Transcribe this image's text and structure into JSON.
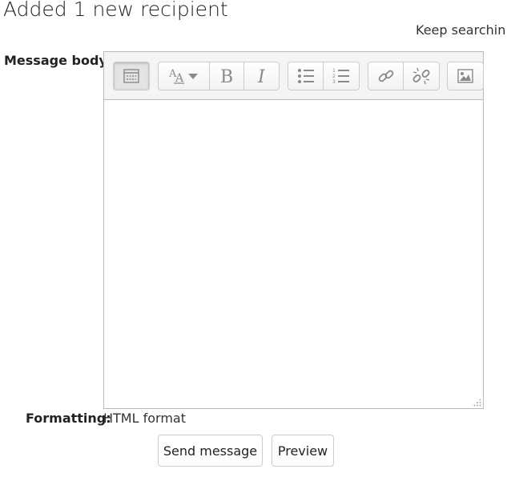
{
  "header": {
    "title": "Added 1 new recipient",
    "keep_searching": "Keep searchin"
  },
  "form": {
    "message_body_label": "Message body:",
    "formatting_label": "Formatting:",
    "formatting_value": "HTML format"
  },
  "toolbar": {
    "buttons": [
      {
        "icon": "toolbar-toggle-icon",
        "state": "pressed"
      },
      {
        "icon": "font-style-icon"
      },
      {
        "icon": "bold-icon"
      },
      {
        "icon": "italic-icon"
      },
      {
        "icon": "unordered-list-icon"
      },
      {
        "icon": "ordered-list-icon"
      },
      {
        "icon": "link-icon"
      },
      {
        "icon": "unlink-icon"
      },
      {
        "icon": "image-icon"
      }
    ]
  },
  "actions": {
    "send_label": "Send message",
    "preview_label": "Preview"
  },
  "colors": {
    "icon": "#8a8a8a",
    "border": "#bbbbbb",
    "toolbar_bg": "#f4f4f4"
  }
}
